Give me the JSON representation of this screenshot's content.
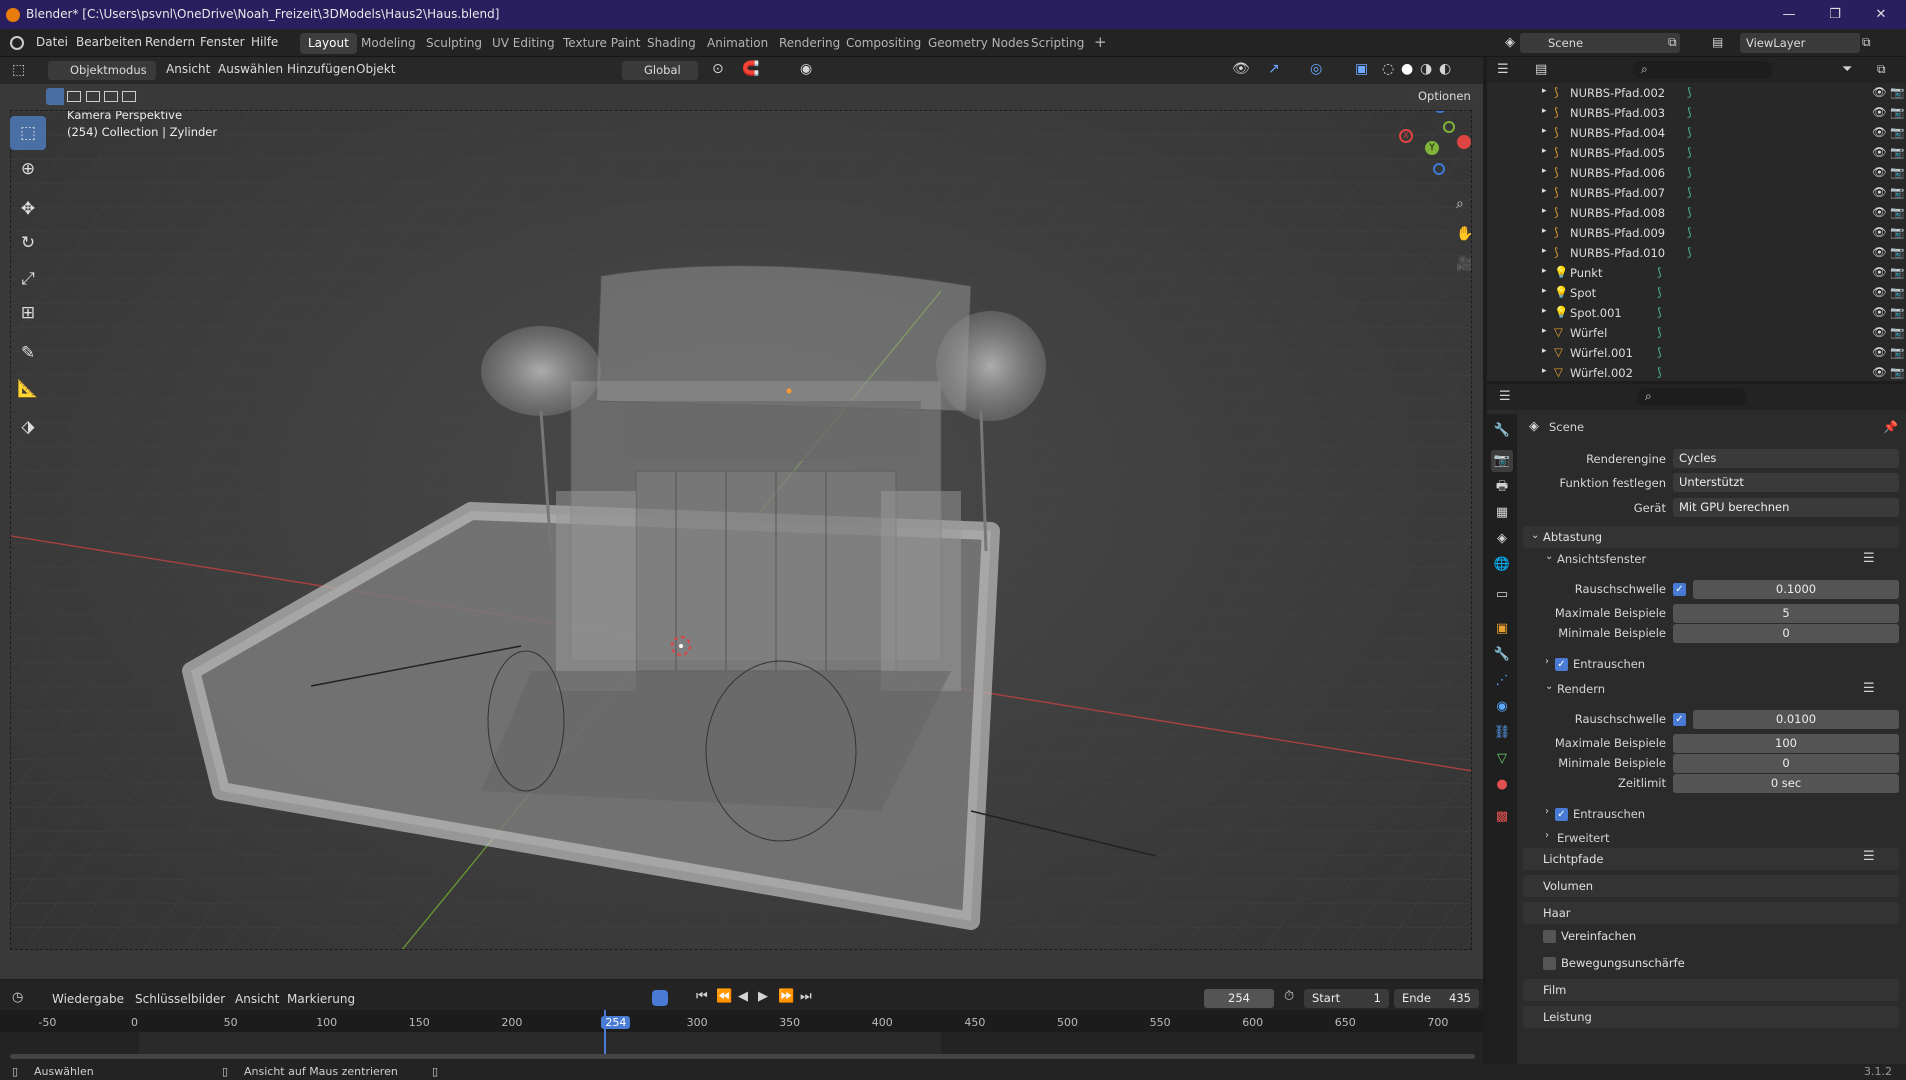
{
  "window": {
    "title": "Blender* [C:\\Users\\psvnl\\OneDrive\\Noah_Freizeit\\3DModels\\Haus2\\Haus.blend]"
  },
  "menu": [
    "Datei",
    "Bearbeiten",
    "Rendern",
    "Fenster",
    "Hilfe"
  ],
  "workspaces": [
    "Layout",
    "Modeling",
    "Sculpting",
    "UV Editing",
    "Texture Paint",
    "Shading",
    "Animation",
    "Rendering",
    "Compositing",
    "Geometry Nodes",
    "Scripting"
  ],
  "active_workspace": "Layout",
  "scene_name": "Scene",
  "viewlayer_name": "ViewLayer",
  "viewport_header": {
    "mode": "Objektmodus",
    "menus": [
      "Ansicht",
      "Auswählen",
      "Hinzufügen",
      "Objekt"
    ],
    "transform": "Global",
    "options": "Optionen"
  },
  "viewport_overlay": {
    "line1": "Kamera Perspektive",
    "line2": "(254) Collection | Zylinder"
  },
  "gizmo": {
    "x": "X",
    "y": "Y",
    "z": "Z"
  },
  "outliner": [
    "NURBS-Pfad.002",
    "NURBS-Pfad.003",
    "NURBS-Pfad.004",
    "NURBS-Pfad.005",
    "NURBS-Pfad.006",
    "NURBS-Pfad.007",
    "NURBS-Pfad.008",
    "NURBS-Pfad.009",
    "NURBS-Pfad.010",
    "Punkt",
    "Spot",
    "Spot.001",
    "Würfel",
    "Würfel.001",
    "Würfel.002"
  ],
  "properties": {
    "context": "Scene",
    "render_engine_label": "Renderengine",
    "render_engine": "Cycles",
    "feature_set_label": "Funktion festlegen",
    "feature_set": "Unterstützt",
    "device_label": "Gerät",
    "device": "Mit GPU berechnen",
    "sampling": "Abtastung",
    "viewport": "Ansichtsfenster",
    "noise_label": "Rauschschwelle",
    "max_samples_label": "Maximale Beispiele",
    "min_samples_label": "Minimale Beispiele",
    "vp_noise": "0.1000",
    "vp_max": "5",
    "vp_min": "0",
    "denoise": "Entrauschen",
    "render": "Rendern",
    "r_noise": "0.0100",
    "r_max": "100",
    "r_min": "0",
    "time_limit_label": "Zeitlimit",
    "time_limit": "0 sec",
    "advanced": "Erweitert",
    "sections": [
      "Lichtpfade",
      "Volumen",
      "Haar",
      "Vereinfachen",
      "Bewegungsunschärfe",
      "Film",
      "Leistung"
    ]
  },
  "timeline": {
    "menus": [
      "Wiedergabe",
      "Schlüsselbilder",
      "Ansicht",
      "Markierung"
    ],
    "current_frame": "254",
    "start_label": "Start",
    "start": "1",
    "end_label": "Ende",
    "end": "435",
    "ticks": [
      "-50",
      "0",
      "50",
      "100",
      "150",
      "200",
      "254",
      "300",
      "350",
      "400",
      "450",
      "500",
      "550",
      "600",
      "650",
      "700"
    ]
  },
  "status": {
    "left": "Auswählen",
    "mid": "Ansicht auf Maus zentrieren",
    "version": "3.1.2"
  }
}
